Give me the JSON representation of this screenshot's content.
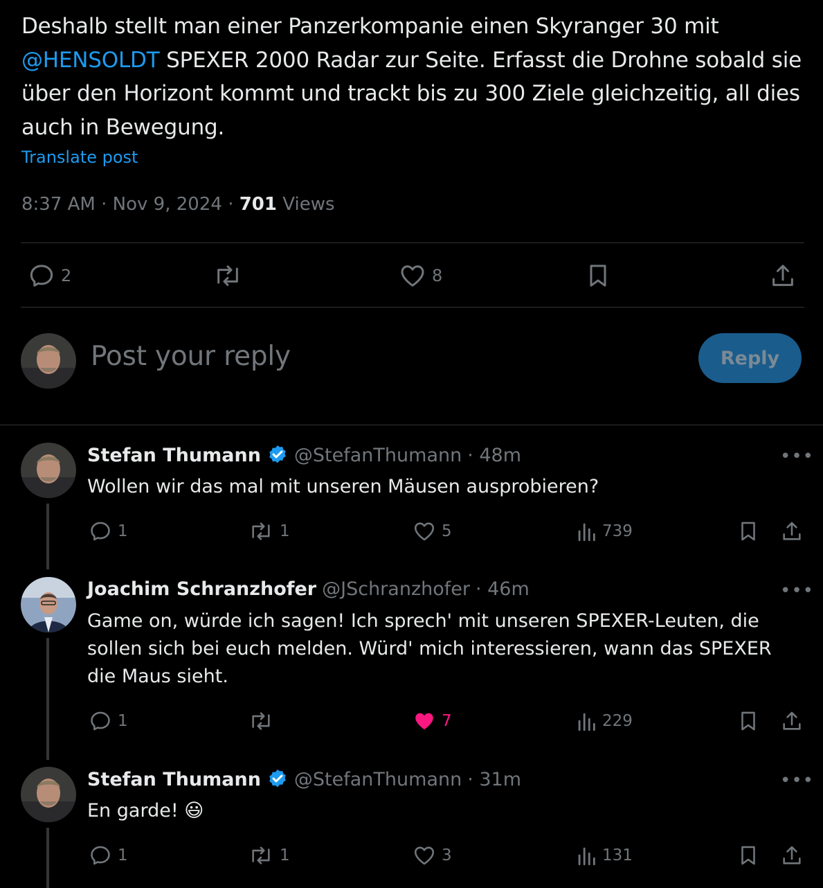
{
  "post": {
    "text_before": "Deshalb stellt man einer Panzerkompanie einen Skyranger 30 mit ",
    "mention": "@HENSOLDT",
    "text_after": " SPEXER 2000 Radar zur Seite. Erfasst die Drohne sobald sie über den Horizont kommt und trackt bis zu 300 Ziele gleichzeitig, all dies auch in Bewegung.",
    "translate_label": "Translate post",
    "time": "8:37 AM",
    "date": "Nov 9, 2024",
    "sep": "·",
    "views_count": "701",
    "views_label": "Views",
    "replies": "2",
    "likes": "8"
  },
  "composer": {
    "placeholder": "Post your reply",
    "reply_label": "Reply"
  },
  "replies": [
    {
      "name": "Stefan Thumann",
      "handle": "@StefanThumann",
      "age": "· 48m",
      "text": "Wollen wir das mal mit unseren Mäusen ausprobieren?",
      "replies": "1",
      "reposts": "1",
      "likes": "5",
      "views": "739"
    },
    {
      "name": "Joachim Schranzhofer",
      "handle": "@JSchranzhofer",
      "age": "· 46m",
      "text_lines": [
        "Game on, würde ich sagen! Ich sprech' mit unseren SPEXER-Leuten, die",
        "sollen sich bei euch melden. Würd' mich interessieren, wann das SPEXER",
        "die Maus sieht."
      ],
      "replies": "1",
      "reposts": "",
      "likes": "7",
      "views": "229"
    },
    {
      "name": "Stefan Thumann",
      "handle": "@StefanThumann",
      "age": "· 31m",
      "text": "En garde! 😃",
      "replies": "1",
      "reposts": "1",
      "likes": "3",
      "views": "131"
    }
  ],
  "more_label": "•••",
  "colors": {
    "accent": "#1d9bf0",
    "like": "#f91880",
    "muted": "#71767b",
    "divider": "#2f3336"
  }
}
